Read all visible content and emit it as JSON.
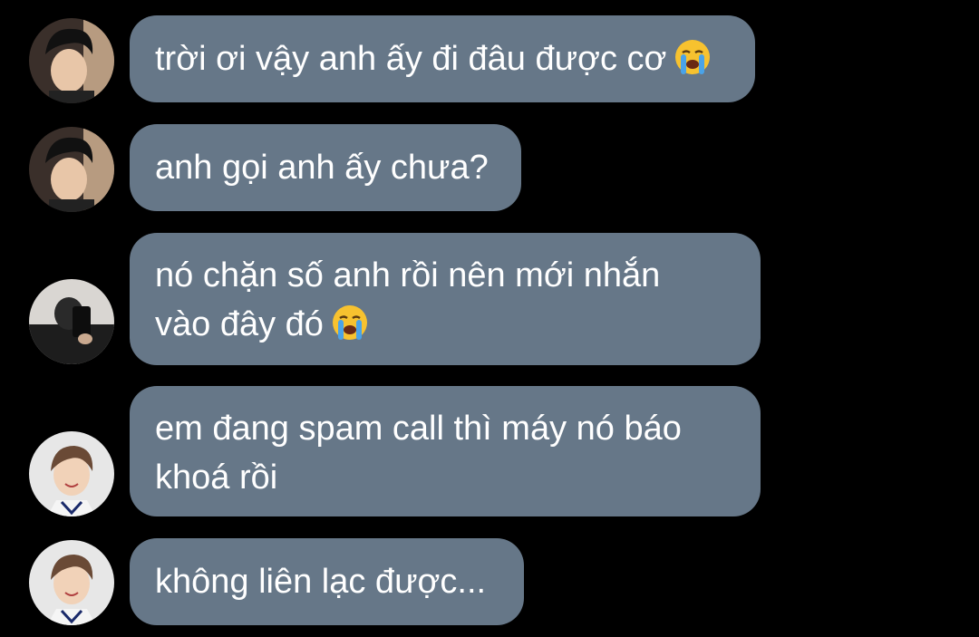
{
  "messages": [
    {
      "text": "trời ơi vậy anh ấy đi đâu được cơ",
      "emoji": "loudly-crying-face",
      "avatar": "avatar-user-a"
    },
    {
      "text": "anh gọi anh ấy chưa?",
      "emoji": null,
      "avatar": "avatar-user-a"
    },
    {
      "text": "nó chặn số anh rồi nên mới nhắn\nvào đây đó",
      "emoji": "loudly-crying-face",
      "avatar": "avatar-user-b"
    },
    {
      "text": "em đang spam call thì máy nó báo\nkhoá rồi",
      "emoji": null,
      "avatar": "avatar-user-c"
    },
    {
      "text": "không liên lạc được...",
      "emoji": null,
      "avatar": "avatar-user-c"
    }
  ],
  "colors": {
    "background": "#000000",
    "bubble": "#667788",
    "text": "#ffffff"
  }
}
